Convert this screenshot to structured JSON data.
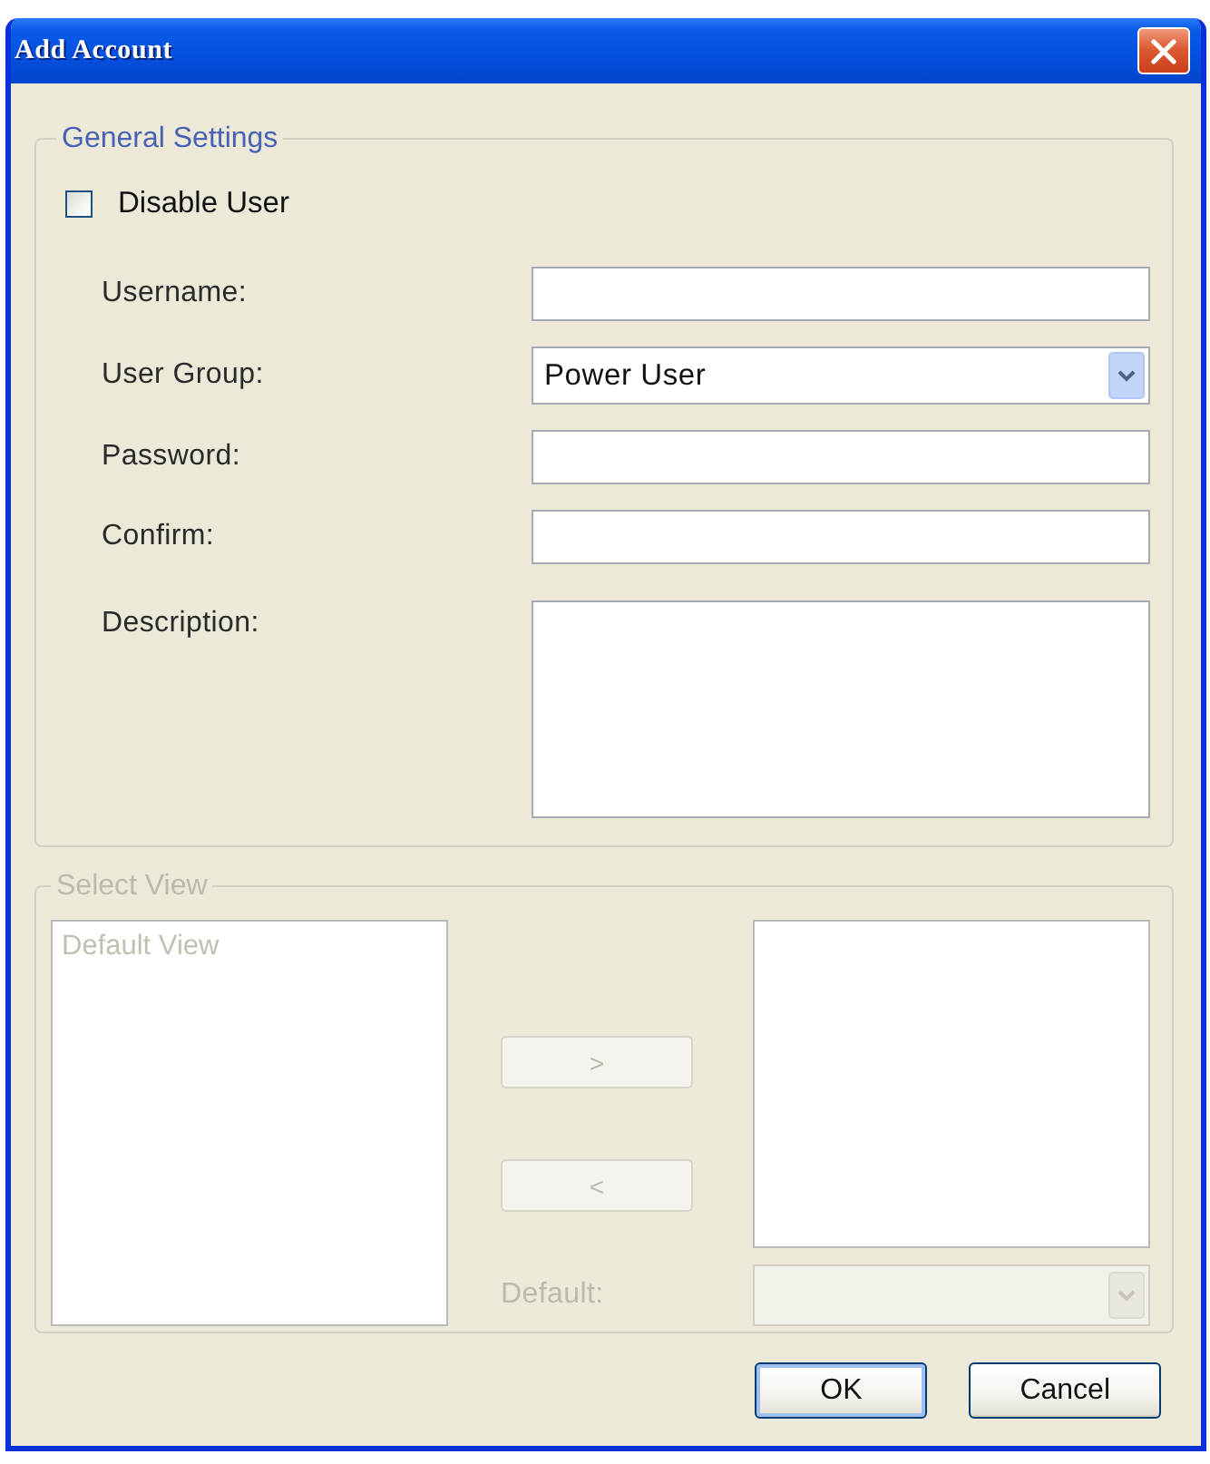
{
  "window": {
    "title": "Add Account"
  },
  "general_settings": {
    "legend": "General Settings",
    "disable_user": {
      "label": "Disable User",
      "checked": false
    },
    "fields": [
      {
        "kind": "text",
        "label": "Username:"
      },
      {
        "kind": "select",
        "label": "User Group:",
        "value": "Power User"
      },
      {
        "kind": "text",
        "label": "Password:"
      },
      {
        "kind": "text",
        "label": "Confirm:"
      },
      {
        "kind": "textarea",
        "label": "Description:"
      }
    ]
  },
  "select_view": {
    "legend": "Select View",
    "disabled": true,
    "available_views": [
      {
        "label": "Default View",
        "selected": false
      }
    ],
    "add_button": ">",
    "remove_button": "<",
    "default_label": "Default:"
  },
  "buttons": [
    {
      "label": "OK",
      "default": true
    },
    {
      "label": "Cancel",
      "default": false
    }
  ]
}
